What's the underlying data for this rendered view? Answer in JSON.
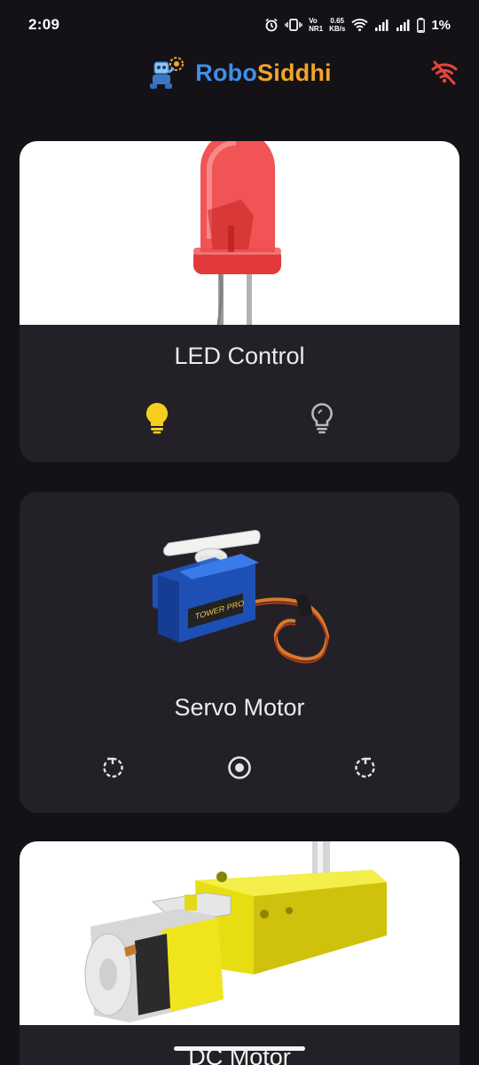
{
  "status_bar": {
    "time": "2:09",
    "volte_top": "Vo",
    "volte_bottom": "NR1",
    "speed_value": "0.65",
    "speed_unit": "KB/s",
    "battery": "1%",
    "icons": [
      "alarm-icon",
      "vibrate-icon",
      "wifi-icon",
      "signal-icon",
      "signal-icon",
      "battery-icon"
    ]
  },
  "app_bar": {
    "brand_part1": "Robo",
    "brand_part2": "Siddhi",
    "connection_icon": "wifi-off-icon",
    "colors": {
      "robo": "#3f8fe6",
      "siddhi": "#f0a52c",
      "disconnected": "#e5453c"
    }
  },
  "cards": [
    {
      "title": "LED Control",
      "image": "red-led-image",
      "controls": [
        "led-on-bulb-icon",
        "led-off-bulb-icon"
      ],
      "active_color": "#f6cf1e"
    },
    {
      "title": "Servo Motor",
      "image": "servo-motor-image",
      "controls": [
        "rotate-left-icon",
        "center-position-icon",
        "rotate-right-icon"
      ]
    },
    {
      "title": "DC Motor",
      "image": "dc-gear-motor-image"
    }
  ]
}
